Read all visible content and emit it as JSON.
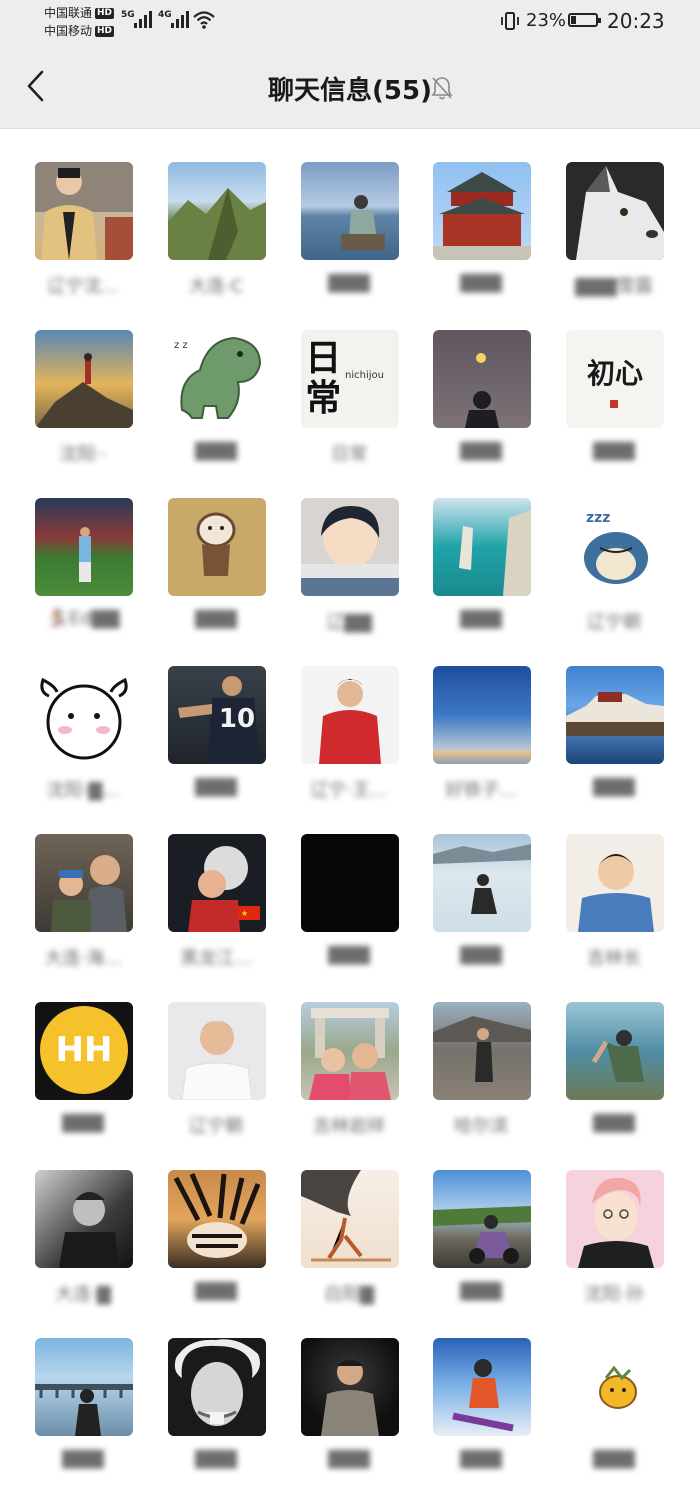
{
  "status_bar": {
    "carrier1": "中国联通",
    "carrier2": "中国移动",
    "hd": "HD",
    "net1": "5G",
    "net2": "4G",
    "battery": "23%",
    "time": "20:23"
  },
  "header": {
    "back_icon": "chevron-left-icon",
    "title": "聊天信息(55)",
    "mute_icon": "bell-muted-icon"
  },
  "avatar_texts": {
    "nichijou_main": "日常",
    "nichijou_sub": "nichijou",
    "chuxin": "初心",
    "hh": "HH",
    "jersey": "10"
  },
  "members": [
    {
      "name": "辽宁沈..."
    },
    {
      "name": "大连·C"
    },
    {
      "name": "▇▇▇"
    },
    {
      "name": "▇▇▇"
    },
    {
      "name": "▇▇▇雪露"
    },
    {
      "name": "沈阳··"
    },
    {
      "name": "▇▇▇"
    },
    {
      "name": "日常"
    },
    {
      "name": "▇▇▇"
    },
    {
      "name": "▇▇▇"
    },
    {
      "name": "🏂Ed▇▇"
    },
    {
      "name": "▇▇▇"
    },
    {
      "name": "辽▇▇"
    },
    {
      "name": "▇▇▇"
    },
    {
      "name": "辽宁朝"
    },
    {
      "name": "沈阳·▇..."
    },
    {
      "name": "▇▇▇"
    },
    {
      "name": "辽宁·王..."
    },
    {
      "name": "好铁子..."
    },
    {
      "name": "▇▇▇"
    },
    {
      "name": "大连·海..."
    },
    {
      "name": "黑龙江..."
    },
    {
      "name": "▇▇▇"
    },
    {
      "name": "▇▇▇"
    },
    {
      "name": "吉林长"
    },
    {
      "name": "▇▇▇"
    },
    {
      "name": "辽宁朝"
    },
    {
      "name": "吉林岩祥"
    },
    {
      "name": "哈尔滨"
    },
    {
      "name": "▇▇▇"
    },
    {
      "name": "大连·▇"
    },
    {
      "name": "▇▇▇"
    },
    {
      "name": "白阳▇"
    },
    {
      "name": "▇▇▇"
    },
    {
      "name": "沈阳·孙"
    },
    {
      "name": "▇▇▇"
    },
    {
      "name": "▇▇▇"
    },
    {
      "name": "▇▇▇"
    },
    {
      "name": "▇▇▇"
    },
    {
      "name": "▇▇▇"
    }
  ]
}
